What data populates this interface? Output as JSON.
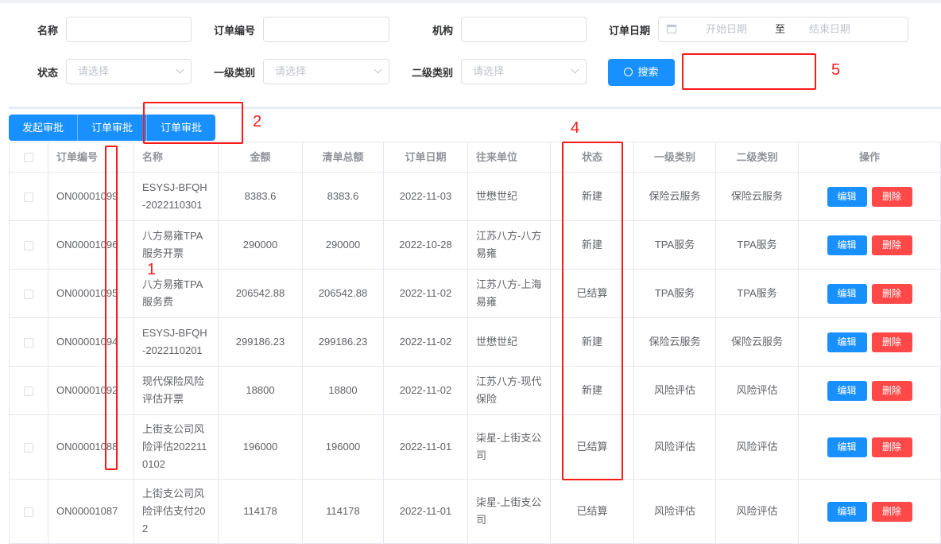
{
  "filters": {
    "name_label": "名称",
    "order_no_label": "订单编号",
    "org_label": "机构",
    "order_date_label": "订单日期",
    "date_start_placeholder": "开始日期",
    "date_sep": "至",
    "date_end_placeholder": "结束日期",
    "status_label": "状态",
    "cat1_label": "一级类别",
    "cat2_label": "二级类别",
    "select_placeholder": "请选择",
    "search_label": "搜索"
  },
  "toolbar": {
    "buttons": [
      "发起审批",
      "订单审批",
      "订单审批"
    ]
  },
  "table": {
    "headers": [
      "订单编号",
      "名称",
      "金额",
      "清单总额",
      "订单日期",
      "往来单位",
      "状态",
      "一级类别",
      "二级类别",
      "操作"
    ],
    "edit_label": "编辑",
    "delete_label": "删除",
    "rows": [
      {
        "no": "ON00001099",
        "name": "ESYSJ-BFQH-2022110301",
        "amount": "8383.6",
        "total": "8383.6",
        "date": "2022-11-03",
        "partner": "世懋世纪",
        "status": "新建",
        "cat1": "保险云服务",
        "cat2": "保险云服务"
      },
      {
        "no": "ON00001096",
        "name": "八方易雍TPA服务开票",
        "amount": "290000",
        "total": "290000",
        "date": "2022-10-28",
        "partner": "江苏八方-八方易雍",
        "status": "新建",
        "cat1": "TPA服务",
        "cat2": "TPA服务"
      },
      {
        "no": "ON00001095",
        "name": "八方易雍TPA服务费",
        "amount": "206542.88",
        "total": "206542.88",
        "date": "2022-11-02",
        "partner": "江苏八方-上海易雍",
        "status": "已结算",
        "cat1": "TPA服务",
        "cat2": "TPA服务"
      },
      {
        "no": "ON00001094",
        "name": "ESYSJ-BFQH-2022110201",
        "amount": "299186.23",
        "total": "299186.23",
        "date": "2022-11-02",
        "partner": "世懋世纪",
        "status": "新建",
        "cat1": "保险云服务",
        "cat2": "保险云服务"
      },
      {
        "no": "ON00001092",
        "name": "现代保险风险评估开票",
        "amount": "18800",
        "total": "18800",
        "date": "2022-11-02",
        "partner": "江苏八方-现代保险",
        "status": "新建",
        "cat1": "风险评估",
        "cat2": "风险评估"
      },
      {
        "no": "ON00001088",
        "name": "上街支公司风险评估2022110102",
        "amount": "196000",
        "total": "196000",
        "date": "2022-11-01",
        "partner": "柒星-上街支公司",
        "status": "已结算",
        "cat1": "风险评估",
        "cat2": "风险评估"
      },
      {
        "no": "ON00001087",
        "name": "上街支公司风险评估支付202",
        "amount": "114178",
        "total": "114178",
        "date": "2022-11-01",
        "partner": "柒星-上街支公司",
        "status": "已结算",
        "cat1": "风险评估",
        "cat2": "风险评估"
      }
    ]
  },
  "annotations": [
    "1",
    "2",
    "4",
    "5"
  ]
}
